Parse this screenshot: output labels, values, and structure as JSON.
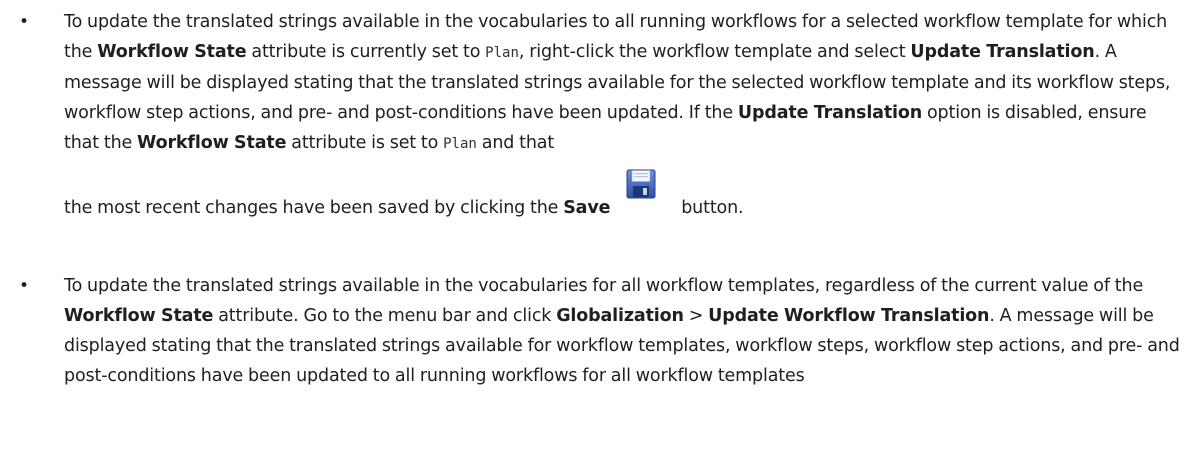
{
  "bullets": [
    {
      "segments": {
        "s1": "To update the translated strings available in the vocabularies to all running workflows for a selected workflow template for which the ",
        "b1": "Workflow State",
        "s2": " attribute is currently set to ",
        "c1": "Plan",
        "s3": ", right-click the workflow template and select ",
        "b2": "Update Translation",
        "s4": ". A message will be displayed stating that the translated strings available for the selected workflow template and its workflow steps, workflow step actions, and pre- and post-conditions have been updated. If the ",
        "b3": "Update Translation",
        "s5": " option is disabled, ensure that the ",
        "b4": "Workflow State",
        "s6": " attribute is set to ",
        "c2": "Plan",
        "s7": " and that",
        "s8": "the most recent changes have been saved by clicking the ",
        "b5": "Save",
        "s9": " button."
      },
      "icon": "save-floppy-icon"
    },
    {
      "segments": {
        "s1": "To update the translated strings available in the vocabularies for all workflow templates, regardless of the current value of the ",
        "b1": "Workflow State",
        "s2": " attribute. Go to the menu bar and click ",
        "b2": "Globalization",
        "s3": " > ",
        "b3": "Update Workflow Translation",
        "s4": ". A message will be displayed stating that the translated strings available for workflow templates, workflow steps, workflow step actions, and pre- and post-conditions have been updated to all running workflows for all workflow templates"
      }
    }
  ],
  "bullet_glyph": "•"
}
